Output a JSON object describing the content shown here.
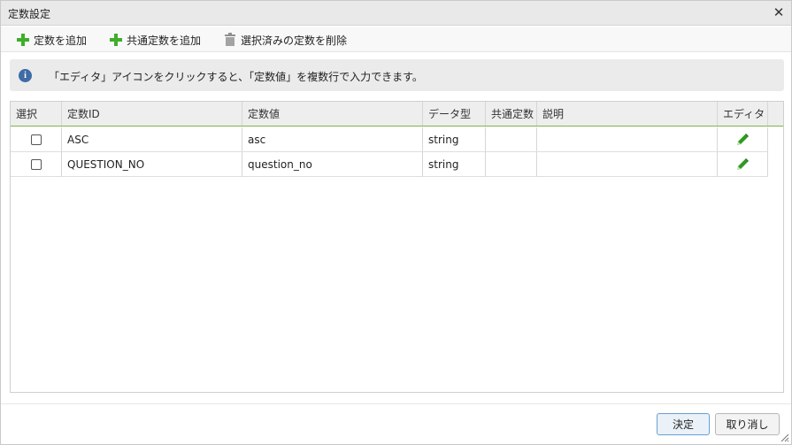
{
  "dialog": {
    "title": "定数設定",
    "close_glyph": "✕"
  },
  "toolbar": {
    "add_label": "定数を追加",
    "add_common_label": "共通定数を追加",
    "delete_label": "選択済みの定数を削除"
  },
  "info": {
    "icon": "i",
    "message": "「エディタ」アイコンをクリックすると、「定数値」を複数行で入力できます。"
  },
  "table": {
    "columns": [
      "選択",
      "定数ID",
      "定数値",
      "データ型",
      "共通定数",
      "説明",
      "エディタ"
    ],
    "rows": [
      {
        "id": "ASC",
        "value": "asc",
        "type": "string",
        "common": "",
        "description": "",
        "checked": false
      },
      {
        "id": "QUESTION_NO",
        "value": "question_no",
        "type": "string",
        "common": "",
        "description": "",
        "checked": false
      }
    ]
  },
  "footer": {
    "ok_label": "決定",
    "cancel_label": "取り消し"
  },
  "icons": {
    "add": "plus-icon",
    "add_common": "plus-icon",
    "delete": "trash-icon",
    "info": "info-icon",
    "editor": "pencil-icon",
    "close": "close-icon"
  },
  "colors": {
    "accent_green": "#3fae2a",
    "header_underline": "#7fb34b",
    "info_blue": "#3f6ba6",
    "pencil_green": "#2e9a1f"
  }
}
